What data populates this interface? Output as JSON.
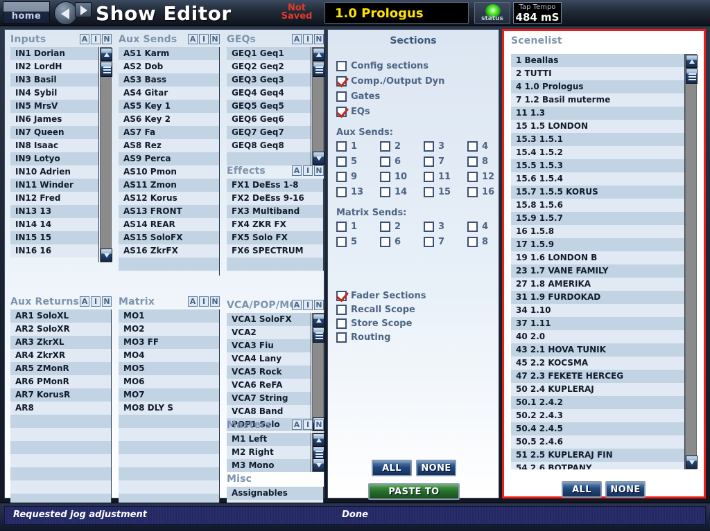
{
  "topbar": {
    "home_label": "home",
    "title": "Show Editor",
    "not_saved": "Not\nSaved",
    "not_saved_line1": "Not",
    "not_saved_line2": "Saved",
    "current_scene": "1.0 Prologus",
    "status_label": "status",
    "tap_tempo_caption": "Tap Tempo",
    "tap_tempo_value": "484 mS"
  },
  "ain_buttons": [
    "A",
    "I",
    "N"
  ],
  "lists": {
    "inputs": {
      "title": "Inputs",
      "rows": [
        "IN1 Dorian",
        "IN2 LordH",
        "IN3 Basil",
        "IN4 Sybil",
        "IN5 MrsV",
        "IN6 James",
        "IN7 Queen",
        "IN8 Isaac",
        "IN9 Lotyo",
        "IN10 Adrien",
        "IN11 Winder",
        "IN12 Fred",
        "IN13 13",
        "IN14 14",
        "IN15 15",
        "IN16 16"
      ]
    },
    "aux_sends": {
      "title": "Aux Sends",
      "rows": [
        "AS1 Karm",
        "AS2 Dob",
        "AS3 Bass",
        "AS4 Gitar",
        "AS5 Key 1",
        "AS6 Key 2",
        "AS7 Fa",
        "AS8 Rez",
        "AS9 Perca",
        "AS10 Pmon",
        "AS11 Zmon",
        "AS12 Korus",
        "AS13 FRONT",
        "AS14 REAR",
        "AS15 SoloFX",
        "AS16 ZkrFX",
        ""
      ]
    },
    "geqs": {
      "title": "GEQs",
      "rows": [
        "GEQ1 Geq1",
        "GEQ2 Geq2",
        "GEQ3 Geq3",
        "GEQ4 Geq4",
        "GEQ5 Geq5",
        "GEQ6 Geq6",
        "GEQ7 Geq7",
        "GEQ8 Geq8",
        ""
      ]
    },
    "effects": {
      "title": "Effects",
      "rows": [
        "FX1 DeEss 1-8",
        "FX2 DeEss 9-16",
        "FX3 Multiband",
        "FX4 ZKR FX",
        "FX5 Solo FX",
        "FX6 SPECTRUM",
        ""
      ]
    },
    "aux_returns": {
      "title": "Aux Returns",
      "rows": [
        "AR1 SoloXL",
        "AR2 SoloXR",
        "AR3 ZkrXL",
        "AR4 ZkrXR",
        "AR5 ZMonR",
        "AR6 PMonR",
        "AR7 KorusR",
        "AR8",
        "",
        "",
        "",
        "",
        "",
        "",
        "",
        "",
        ""
      ]
    },
    "matrix": {
      "title": "Matrix",
      "rows": [
        "MO1",
        "MO2",
        "MO3 FF",
        "MO4",
        "MO5",
        "MO6",
        "MO7",
        "MO8 DLY S",
        "",
        "",
        "",
        "",
        "",
        "",
        "",
        "",
        ""
      ]
    },
    "vca": {
      "title": "VCA/POP/MG",
      "rows": [
        "VCA1 SoloFX",
        "VCA2",
        "VCA3 Fiu",
        "VCA4 Lany",
        "VCA5 Rock",
        "VCA6 ReFA",
        "VCA7 String",
        "VCA8 Band",
        "POP1 Solo"
      ]
    },
    "masters": {
      "title": "Masters",
      "rows": [
        "M1 Left",
        "M2 Right",
        "M3 Mono"
      ]
    },
    "misc": {
      "title": "Misc",
      "rows": [
        "Assignables",
        "",
        ""
      ]
    }
  },
  "sections": {
    "title": "Sections",
    "top_checks": [
      {
        "label": "Config sections",
        "checked": false
      },
      {
        "label": "Comp./Output Dyn",
        "checked": true
      },
      {
        "label": "Gates",
        "checked": false
      },
      {
        "label": "EQs",
        "checked": true
      }
    ],
    "aux_sends_label": "Aux Sends:",
    "aux_sends_numbers": [
      "1",
      "2",
      "3",
      "4",
      "5",
      "6",
      "7",
      "8",
      "9",
      "10",
      "11",
      "12",
      "13",
      "14",
      "15",
      "16"
    ],
    "matrix_sends_label": "Matrix Sends:",
    "matrix_sends_numbers": [
      "1",
      "2",
      "3",
      "4",
      "5",
      "6",
      "7",
      "8"
    ],
    "bottom_checks": [
      {
        "label": "Fader Sections",
        "checked": true
      },
      {
        "label": "Recall Scope",
        "checked": false
      },
      {
        "label": "Store Scope",
        "checked": false
      },
      {
        "label": "Routing",
        "checked": false
      }
    ],
    "all_label": "ALL",
    "none_label": "NONE",
    "paste_label": "PASTE TO SCENES"
  },
  "scenelist": {
    "title": "Scenelist",
    "rows": [
      "1 Beallas",
      "2 TUTTI",
      "4 1.0 Prologus",
      "7 1.2 Basil muterme",
      "11 1.3",
      "15 1.5 LONDON",
      "15.3 1.5.1",
      "15.4 1.5.2",
      "15.5 1.5.3",
      "15.6 1.5.4",
      "15.7 1.5.5 KORUS",
      "15.8 1.5.6",
      "15.9 1.5.7",
      "16 1.5.8",
      "17 1.5.9",
      "19 1.6 LONDON B",
      "23 1.7 VANE FAMILY",
      "27 1.8 AMERIKA",
      "31 1.9 FURDOKAD",
      "34 1.10",
      "37 1.11",
      "40 2.0",
      "43 2.1 HOVA TUNIK",
      "45 2.2 KOCSMA",
      "47 2.3 FEKETE HERCEG",
      "50 2.4 KUPLERAJ",
      "50.1 2.4.2",
      "50.2 2.4.3",
      "50.4 2.4.5",
      "50.5 2.4.6",
      "51 2.5 KUPLERAJ FIN",
      "54 2.6 BOTPANY"
    ],
    "all_label": "ALL",
    "none_label": "NONE"
  },
  "statusbar": {
    "left": "Requested jog adjustment",
    "center": "Done"
  },
  "colors": {
    "accent_red": "#ec1c16",
    "scene_yellow": "#ffe400",
    "header_blue": "#7d93ad",
    "paste_green": "#25702a"
  }
}
